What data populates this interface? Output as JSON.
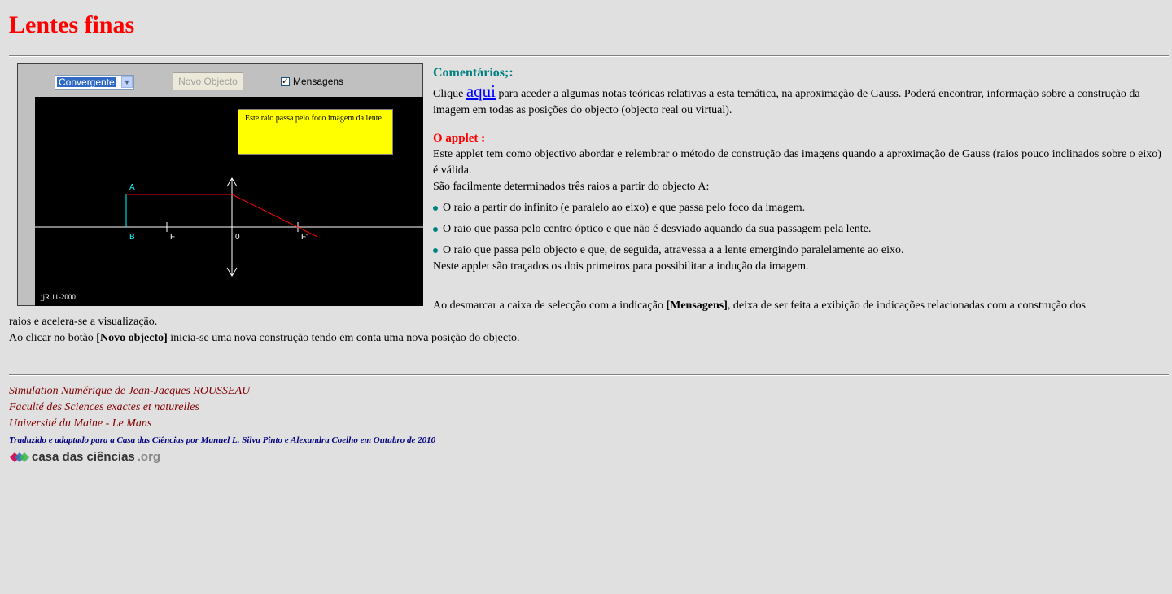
{
  "page": {
    "title": "Lentes finas"
  },
  "applet": {
    "select_value": "Convergente",
    "button_label": "Novo Objecto",
    "checkbox_label": "Mensagens",
    "checkbox_checked": true,
    "message": "Este raio passa pelo foco imagem da lente.",
    "label_a": "A",
    "label_b": "B",
    "label_f": "F",
    "label_o": "0",
    "label_fp": "F'",
    "signature": "jjR 11-2000",
    "colors": {
      "background": "#000000",
      "axis": "#ffffff",
      "object": "#00ffff",
      "ray": "#ff0000",
      "message_bg": "#ffff00"
    }
  },
  "content": {
    "comments_heading": "Comentários;:",
    "comments_pre": "Clique ",
    "comments_link": "aqui",
    "comments_post": " para aceder a algumas notas teóricas relativas a esta temática, na aproximação de Gauss. Poderá encontrar, informação sobre a construção da imagem em todas as posições do objecto (objecto real ou virtual).",
    "applet_heading": "O applet :",
    "applet_p1": "Este applet tem como objectivo abordar e relembrar o método de construção das imagens quando a aproximação de Gauss (raios pouco inclinados sobre o eixo) é válida.",
    "applet_p2": "São facilmente determinados três raios a partir do objecto A:",
    "bullets": [
      "O raio a partir do infinito (e paralelo ao eixo) e que passa pelo foco da imagem.",
      "O raio que passa pelo centro óptico e que não é desviado aquando da sua passagem pela lente.",
      "O raio que passa pelo objecto e que, de seguida, atravessa a a lente emergindo paralelamente ao eixo."
    ],
    "applet_p3": "Neste applet são traçados os dois primeiros para possibilitar a indução da imagem.",
    "desmarcar_pre": "Ao desmarcar a caixa de selecção com a indicação ",
    "desmarcar_bold": "[Mensagens]",
    "desmarcar_post": ", deixa de ser feita a exibição de indicações relacionadas com a construção dos",
    "desmarcar_cont": "raios e acelera-se a visualização.",
    "clicar_pre": "Ao clicar no botão ",
    "clicar_bold": "[Novo objecto]",
    "clicar_post": " inicia-se uma nova construção tendo em conta uma nova posição do objecto."
  },
  "footer": {
    "line1": "Simulation Numérique de Jean-Jacques ROUSSEAU",
    "line2": "Faculté des Sciences exactes et naturelles",
    "line3": "Université du Maine - Le Mans",
    "translated": "Traduzido e adaptado para a Casa das Ciências por Manuel L. Silva Pinto e Alexandra Coelho em Outubro de 2010",
    "logo_main": "casa das ciências",
    "logo_org": ".org"
  }
}
